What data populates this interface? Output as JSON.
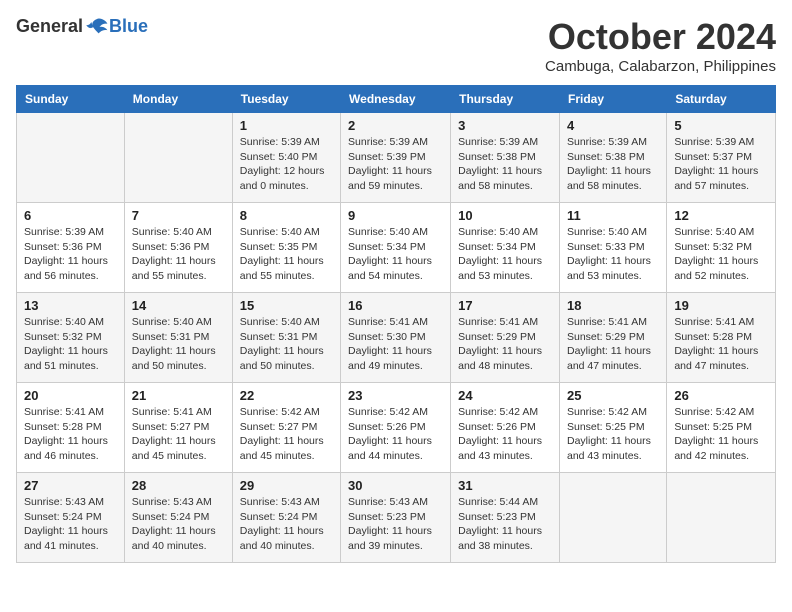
{
  "logo": {
    "general": "General",
    "blue": "Blue"
  },
  "title": {
    "month": "October 2024",
    "location": "Cambuga, Calabarzon, Philippines"
  },
  "headers": [
    "Sunday",
    "Monday",
    "Tuesday",
    "Wednesday",
    "Thursday",
    "Friday",
    "Saturday"
  ],
  "weeks": [
    [
      {
        "day": "",
        "info": ""
      },
      {
        "day": "",
        "info": ""
      },
      {
        "day": "1",
        "info": "Sunrise: 5:39 AM\nSunset: 5:40 PM\nDaylight: 12 hours and 0 minutes."
      },
      {
        "day": "2",
        "info": "Sunrise: 5:39 AM\nSunset: 5:39 PM\nDaylight: 11 hours and 59 minutes."
      },
      {
        "day": "3",
        "info": "Sunrise: 5:39 AM\nSunset: 5:38 PM\nDaylight: 11 hours and 58 minutes."
      },
      {
        "day": "4",
        "info": "Sunrise: 5:39 AM\nSunset: 5:38 PM\nDaylight: 11 hours and 58 minutes."
      },
      {
        "day": "5",
        "info": "Sunrise: 5:39 AM\nSunset: 5:37 PM\nDaylight: 11 hours and 57 minutes."
      }
    ],
    [
      {
        "day": "6",
        "info": "Sunrise: 5:39 AM\nSunset: 5:36 PM\nDaylight: 11 hours and 56 minutes."
      },
      {
        "day": "7",
        "info": "Sunrise: 5:40 AM\nSunset: 5:36 PM\nDaylight: 11 hours and 55 minutes."
      },
      {
        "day": "8",
        "info": "Sunrise: 5:40 AM\nSunset: 5:35 PM\nDaylight: 11 hours and 55 minutes."
      },
      {
        "day": "9",
        "info": "Sunrise: 5:40 AM\nSunset: 5:34 PM\nDaylight: 11 hours and 54 minutes."
      },
      {
        "day": "10",
        "info": "Sunrise: 5:40 AM\nSunset: 5:34 PM\nDaylight: 11 hours and 53 minutes."
      },
      {
        "day": "11",
        "info": "Sunrise: 5:40 AM\nSunset: 5:33 PM\nDaylight: 11 hours and 53 minutes."
      },
      {
        "day": "12",
        "info": "Sunrise: 5:40 AM\nSunset: 5:32 PM\nDaylight: 11 hours and 52 minutes."
      }
    ],
    [
      {
        "day": "13",
        "info": "Sunrise: 5:40 AM\nSunset: 5:32 PM\nDaylight: 11 hours and 51 minutes."
      },
      {
        "day": "14",
        "info": "Sunrise: 5:40 AM\nSunset: 5:31 PM\nDaylight: 11 hours and 50 minutes."
      },
      {
        "day": "15",
        "info": "Sunrise: 5:40 AM\nSunset: 5:31 PM\nDaylight: 11 hours and 50 minutes."
      },
      {
        "day": "16",
        "info": "Sunrise: 5:41 AM\nSunset: 5:30 PM\nDaylight: 11 hours and 49 minutes."
      },
      {
        "day": "17",
        "info": "Sunrise: 5:41 AM\nSunset: 5:29 PM\nDaylight: 11 hours and 48 minutes."
      },
      {
        "day": "18",
        "info": "Sunrise: 5:41 AM\nSunset: 5:29 PM\nDaylight: 11 hours and 47 minutes."
      },
      {
        "day": "19",
        "info": "Sunrise: 5:41 AM\nSunset: 5:28 PM\nDaylight: 11 hours and 47 minutes."
      }
    ],
    [
      {
        "day": "20",
        "info": "Sunrise: 5:41 AM\nSunset: 5:28 PM\nDaylight: 11 hours and 46 minutes."
      },
      {
        "day": "21",
        "info": "Sunrise: 5:41 AM\nSunset: 5:27 PM\nDaylight: 11 hours and 45 minutes."
      },
      {
        "day": "22",
        "info": "Sunrise: 5:42 AM\nSunset: 5:27 PM\nDaylight: 11 hours and 45 minutes."
      },
      {
        "day": "23",
        "info": "Sunrise: 5:42 AM\nSunset: 5:26 PM\nDaylight: 11 hours and 44 minutes."
      },
      {
        "day": "24",
        "info": "Sunrise: 5:42 AM\nSunset: 5:26 PM\nDaylight: 11 hours and 43 minutes."
      },
      {
        "day": "25",
        "info": "Sunrise: 5:42 AM\nSunset: 5:25 PM\nDaylight: 11 hours and 43 minutes."
      },
      {
        "day": "26",
        "info": "Sunrise: 5:42 AM\nSunset: 5:25 PM\nDaylight: 11 hours and 42 minutes."
      }
    ],
    [
      {
        "day": "27",
        "info": "Sunrise: 5:43 AM\nSunset: 5:24 PM\nDaylight: 11 hours and 41 minutes."
      },
      {
        "day": "28",
        "info": "Sunrise: 5:43 AM\nSunset: 5:24 PM\nDaylight: 11 hours and 40 minutes."
      },
      {
        "day": "29",
        "info": "Sunrise: 5:43 AM\nSunset: 5:24 PM\nDaylight: 11 hours and 40 minutes."
      },
      {
        "day": "30",
        "info": "Sunrise: 5:43 AM\nSunset: 5:23 PM\nDaylight: 11 hours and 39 minutes."
      },
      {
        "day": "31",
        "info": "Sunrise: 5:44 AM\nSunset: 5:23 PM\nDaylight: 11 hours and 38 minutes."
      },
      {
        "day": "",
        "info": ""
      },
      {
        "day": "",
        "info": ""
      }
    ]
  ]
}
